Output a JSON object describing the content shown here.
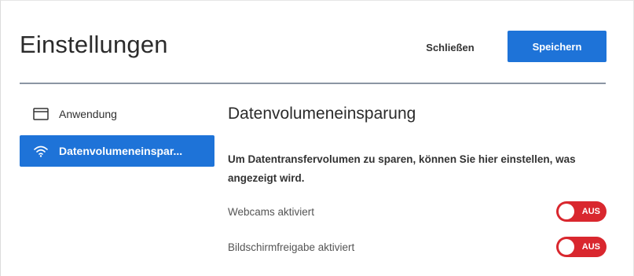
{
  "header": {
    "title": "Einstellungen",
    "close_label": "Schließen",
    "save_label": "Speichern"
  },
  "sidebar": {
    "items": [
      {
        "label": "Anwendung",
        "icon": "window-icon",
        "active": false
      },
      {
        "label": "Datenvolumeneinspar...",
        "icon": "wifi-icon",
        "active": true
      }
    ]
  },
  "main": {
    "section_title": "Datenvolumeneinsparung",
    "description": "Um Datentransfervolumen zu sparen, können Sie hier einstellen, was angezeigt wird.",
    "settings": [
      {
        "label": "Webcams aktiviert",
        "state_label": "AUS",
        "enabled": false
      },
      {
        "label": "Bildschirmfreigabe aktiviert",
        "state_label": "AUS",
        "enabled": false
      }
    ]
  },
  "colors": {
    "accent": "#1e73d8",
    "toggle_off": "#d9272e",
    "divider": "#8b95a3"
  }
}
